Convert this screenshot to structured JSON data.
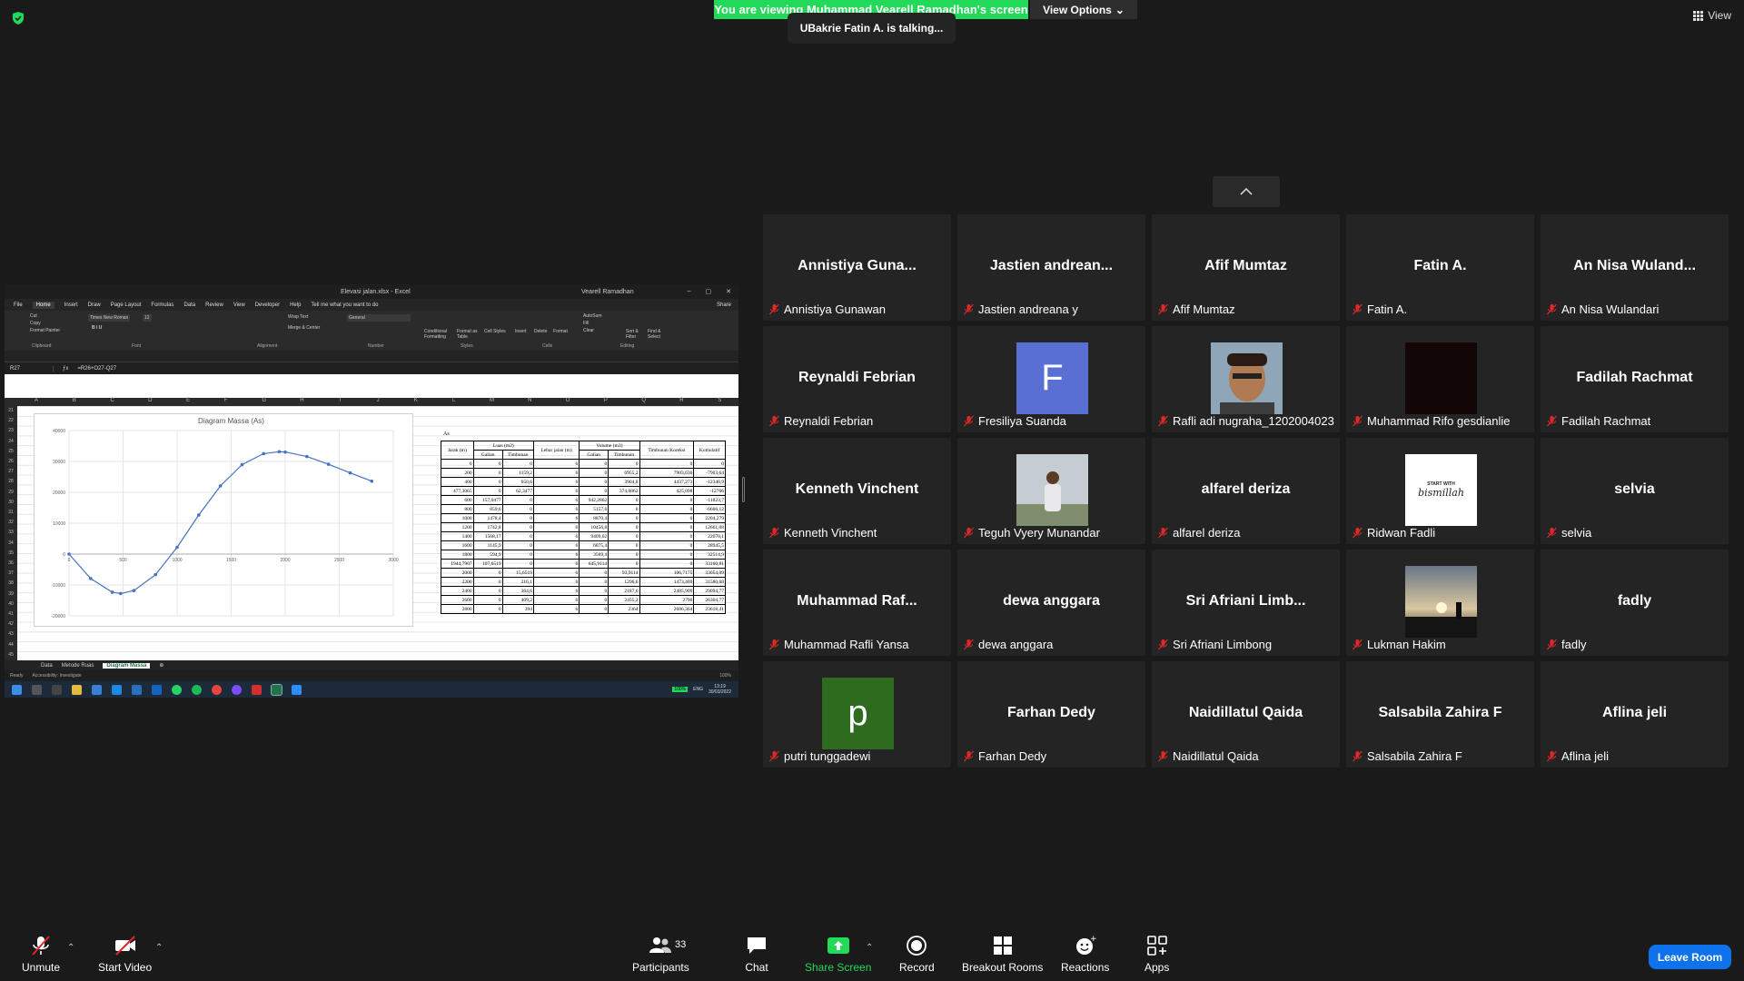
{
  "banner": {
    "viewing_text": "You are viewing Muhammad Vearell Ramadhan's screen",
    "view_options": "View Options",
    "talking": "UBakrie Fatin A. is talking...",
    "view_label": "View"
  },
  "excel": {
    "window_title": "Elevasi jalan.xlsx - Excel",
    "user": "Vearell Ramadhan",
    "menu": [
      "File",
      "Home",
      "Insert",
      "Draw",
      "Page Layout",
      "Formulas",
      "Data",
      "Review",
      "View",
      "Developer",
      "Help",
      "Tell me what you want to do",
      "Share"
    ],
    "ribbon": {
      "font_name": "Times New Roman",
      "font_size": "12",
      "number_format": "General",
      "clipboard_items": [
        "Cut",
        "Copy",
        "Format Painter"
      ],
      "wrap_text": "Wrap Text",
      "merge_center": "Merge & Center",
      "conditional": "Conditional Formatting",
      "format_table": "Format as Table",
      "cell_styles": "Cell Styles",
      "insert": "Insert",
      "delete": "Delete",
      "format": "Format",
      "autosum": "AutoSum",
      "fill": "Fill",
      "clear": "Clear",
      "sort_filter": "Sort & Filter",
      "find_select": "Find & Select",
      "groups": [
        "Clipboard",
        "Font",
        "Alignment",
        "Number",
        "Styles",
        "Cells",
        "Editing"
      ]
    },
    "name_box": "R27",
    "formula": "=R26+O27-Q27",
    "columns": [
      "A",
      "B",
      "C",
      "D",
      "E",
      "F",
      "G",
      "H",
      "I",
      "J",
      "K",
      "L",
      "M",
      "N",
      "O",
      "P",
      "Q",
      "R",
      "S"
    ],
    "rows": [
      "21",
      "22",
      "23",
      "24",
      "25",
      "26",
      "27",
      "28",
      "29",
      "30",
      "31",
      "32",
      "33",
      "34",
      "35",
      "36",
      "37",
      "38",
      "39",
      "40",
      "41",
      "42",
      "43",
      "44",
      "45"
    ],
    "sheet_tabs": [
      "Data",
      "Metode Ruas",
      "Diagram Massa"
    ],
    "active_tab": "Diagram Massa",
    "status": {
      "ready": "Ready",
      "accessibility": "Accessibility: Investigate",
      "zoom": "100%"
    },
    "taskbar": {
      "battery": "100%",
      "lang": "ENG",
      "time": "13:19",
      "date": "30/03/2022"
    },
    "table": {
      "label": "As",
      "headers": {
        "jarak": "Jarak (m)",
        "luas": "Luas (m2)",
        "lebar": "Lebar jalan (m)",
        "volume": "Volume (m3)",
        "timbunan_koreksi": "Timbunan Koreksi",
        "kumulatif": "Kumulatif",
        "galian": "Galian",
        "timbunan": "Timbunan"
      },
      "rows": [
        [
          "0",
          "0",
          "0",
          "6",
          "0",
          "0",
          "0",
          "0"
        ],
        [
          "200",
          "0",
          "1159,2",
          "6",
          "0",
          "6955,2",
          "7903,636",
          "-7903,64"
        ],
        [
          "400",
          "0",
          "650,6",
          "6",
          "0",
          "3904,8",
          "4437,273",
          "-12340,9"
        ],
        [
          "477,3065",
          "0",
          "62,3477",
          "6",
          "0",
          "374,0862",
          "425,098",
          "-12766"
        ],
        [
          "600",
          "157,0477",
          "0",
          "6",
          "942,2862",
          "0",
          "0",
          "-11823,7"
        ],
        [
          "800",
          "859,6",
          "0",
          "6",
          "5157,6",
          "0",
          "0",
          "-6666,12"
        ],
        [
          "1000",
          "1478,4",
          "0",
          "6",
          "8870,4",
          "0",
          "0",
          "2204,279"
        ],
        [
          "1200",
          "1742,8",
          "0",
          "6",
          "10456,8",
          "0",
          "0",
          "12661,08"
        ],
        [
          "1400",
          "1568,17",
          "0",
          "6",
          "9409,02",
          "0",
          "0",
          "22070,1"
        ],
        [
          "1600",
          "1145,9",
          "0",
          "6",
          "6875,4",
          "0",
          "0",
          "28945,5"
        ],
        [
          "1800",
          "594,9",
          "0",
          "6",
          "3569,4",
          "0",
          "0",
          "32514,9"
        ],
        [
          "1944,7907",
          "107,6519",
          "0",
          "6",
          "645,9114",
          "0",
          "0",
          "33160,81"
        ],
        [
          "2000",
          "0",
          "15,6519",
          "6",
          "0",
          "93,9114",
          "106,7175",
          "33054,09"
        ],
        [
          "2200",
          "0",
          "216,1",
          "6",
          "0",
          "1296,6",
          "1473,409",
          "31580,68"
        ],
        [
          "2400",
          "0",
          "364,6",
          "6",
          "0",
          "2187,6",
          "2485,909",
          "29094,77"
        ],
        [
          "2600",
          "0",
          "409,2",
          "6",
          "0",
          "2455,2",
          "2790",
          "26304,77"
        ],
        [
          "2800",
          "0",
          "394",
          "6",
          "0",
          "2364",
          "2686,364",
          "23618,41"
        ]
      ]
    }
  },
  "chart_data": {
    "type": "line",
    "title": "Diagram Massa (As)",
    "x": [
      0,
      200,
      400,
      477.3065,
      600,
      800,
      1000,
      1200,
      1400,
      1600,
      1800,
      1944.7907,
      2000,
      2200,
      2400,
      2600,
      2800
    ],
    "y": [
      0,
      -7903.64,
      -12340.9,
      -12766,
      -11823.7,
      -6666.12,
      2204.279,
      12661.08,
      22070.1,
      28945.5,
      32514.9,
      33160.81,
      33054.09,
      31580.68,
      29094.77,
      26304.77,
      23618.41
    ],
    "xlim": [
      0,
      3000
    ],
    "ylim": [
      -20000,
      40000
    ],
    "xticks": [
      "0",
      "500",
      "1000",
      "1500",
      "2000",
      "2500",
      "3000"
    ],
    "yticks": [
      "40000",
      "30000",
      "20000",
      "10000",
      "0",
      "-10000",
      "-20000"
    ],
    "xlabel": "",
    "ylabel": "",
    "grid": true,
    "color": "#4472c4"
  },
  "participants": [
    {
      "big": "Annistiya Guna...",
      "name": "Annistiya Gunawan"
    },
    {
      "big": "Jastien andrean...",
      "name": "Jastien andreana y"
    },
    {
      "big": "Afif Mumtaz",
      "name": "Afif Mumtaz"
    },
    {
      "big": "Fatin A.",
      "name": "Fatin A."
    },
    {
      "big": "An Nisa Wuland...",
      "name": "An Nisa Wulandari"
    },
    {
      "big": "Reynaldi Febrian",
      "name": "Reynaldi Febrian"
    },
    {
      "letter": "F",
      "color": "#5a6fd3",
      "name": "Fresiliya Suanda"
    },
    {
      "photo": "face",
      "name": "Rafli adi nugraha_1202004023"
    },
    {
      "photo": "dark",
      "name": "Muhammad Rifo gesdianlie"
    },
    {
      "big": "Fadilah Rachmat",
      "name": "Fadilah Rachmat"
    },
    {
      "big": "Kenneth Vinchent",
      "name": "Kenneth Vinchent"
    },
    {
      "photo": "person",
      "name": "Teguh Vyery Munandar"
    },
    {
      "big": "alfarel deriza",
      "name": "alfarel deriza"
    },
    {
      "photo": "text",
      "photo_text_top": "START WITH",
      "photo_text": "bismillah",
      "name": "Ridwan Fadli"
    },
    {
      "big": "selvia",
      "name": "selvia"
    },
    {
      "big": "Muhammad Raf...",
      "name": "Muhammad Rafli Yansa"
    },
    {
      "big": "dewa anggara",
      "name": "dewa anggara"
    },
    {
      "big": "Sri Afriani Limb...",
      "name": "Sri Afriani Limbong"
    },
    {
      "photo": "sunset",
      "name": "Lukman Hakim"
    },
    {
      "big": "fadly",
      "name": "fadly"
    },
    {
      "letter": "p",
      "color": "#2f6b1e",
      "name": "putri tunggadewi"
    },
    {
      "big": "Farhan Dedy",
      "name": "Farhan Dedy"
    },
    {
      "big": "Naidillatul Qaida",
      "name": "Naidillatul Qaida"
    },
    {
      "big": "Salsabila Zahira F",
      "name": "Salsabila Zahira F"
    },
    {
      "big": "Aflina jeli",
      "name": "Aflina jeli"
    }
  ],
  "toolbar": {
    "unmute": "Unmute",
    "start_video": "Start Video",
    "participants": "Participants",
    "participants_count": "33",
    "chat": "Chat",
    "share_screen": "Share Screen",
    "record": "Record",
    "breakout": "Breakout Rooms",
    "reactions": "Reactions",
    "apps": "Apps",
    "leave": "Leave Room"
  }
}
